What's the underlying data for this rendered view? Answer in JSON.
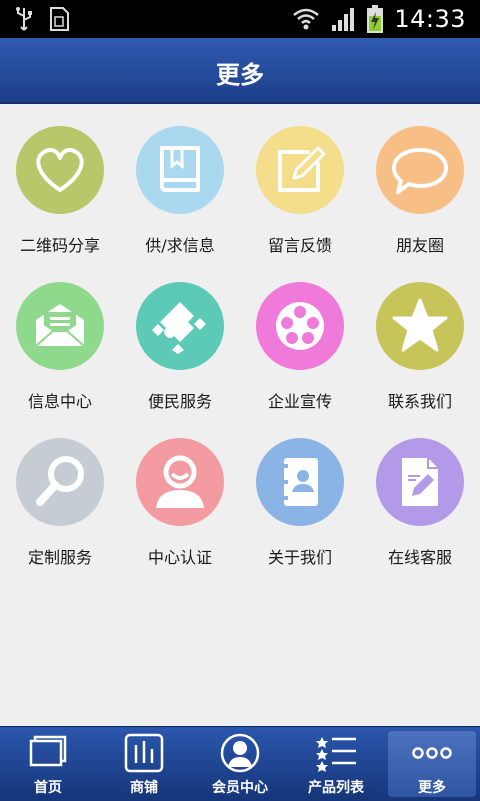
{
  "status_bar": {
    "time": "14:33",
    "left_icons": [
      "usb-icon",
      "sim-icon"
    ],
    "right_icons": [
      "wifi-icon",
      "signal-icon",
      "battery-icon"
    ]
  },
  "header": {
    "title": "更多"
  },
  "grid": {
    "items": [
      {
        "label": "二维码分享",
        "icon": "heart-icon",
        "color": "#b8c76a"
      },
      {
        "label": "供/求信息",
        "icon": "book-icon",
        "color": "#a9d8ef"
      },
      {
        "label": "留言反馈",
        "icon": "edit-icon",
        "color": "#f4de8c"
      },
      {
        "label": "朋友圈",
        "icon": "speech-bubble-icon",
        "color": "#f7bf86"
      },
      {
        "label": "信息中心",
        "icon": "envelope-icon",
        "color": "#8fd98c"
      },
      {
        "label": "便民服务",
        "icon": "puzzle-icon",
        "color": "#5ccab7"
      },
      {
        "label": "企业宣传",
        "icon": "film-reel-icon",
        "color": "#f07ad9"
      },
      {
        "label": "联系我们",
        "icon": "star-icon",
        "color": "#c7c45a"
      },
      {
        "label": "定制服务",
        "icon": "magnifier-icon",
        "color": "#c6ccd3"
      },
      {
        "label": "中心认证",
        "icon": "user-icon",
        "color": "#f49aa1"
      },
      {
        "label": "关于我们",
        "icon": "contacts-icon",
        "color": "#8ab4e6"
      },
      {
        "label": "在线客服",
        "icon": "document-edit-icon",
        "color": "#b29ae8"
      }
    ]
  },
  "bottom_nav": {
    "items": [
      {
        "label": "首页",
        "icon": "home-icon"
      },
      {
        "label": "商铺",
        "icon": "shop-icon"
      },
      {
        "label": "会员中心",
        "icon": "member-icon"
      },
      {
        "label": "产品列表",
        "icon": "list-icon"
      },
      {
        "label": "更多",
        "icon": "more-icon",
        "active": true
      }
    ]
  }
}
